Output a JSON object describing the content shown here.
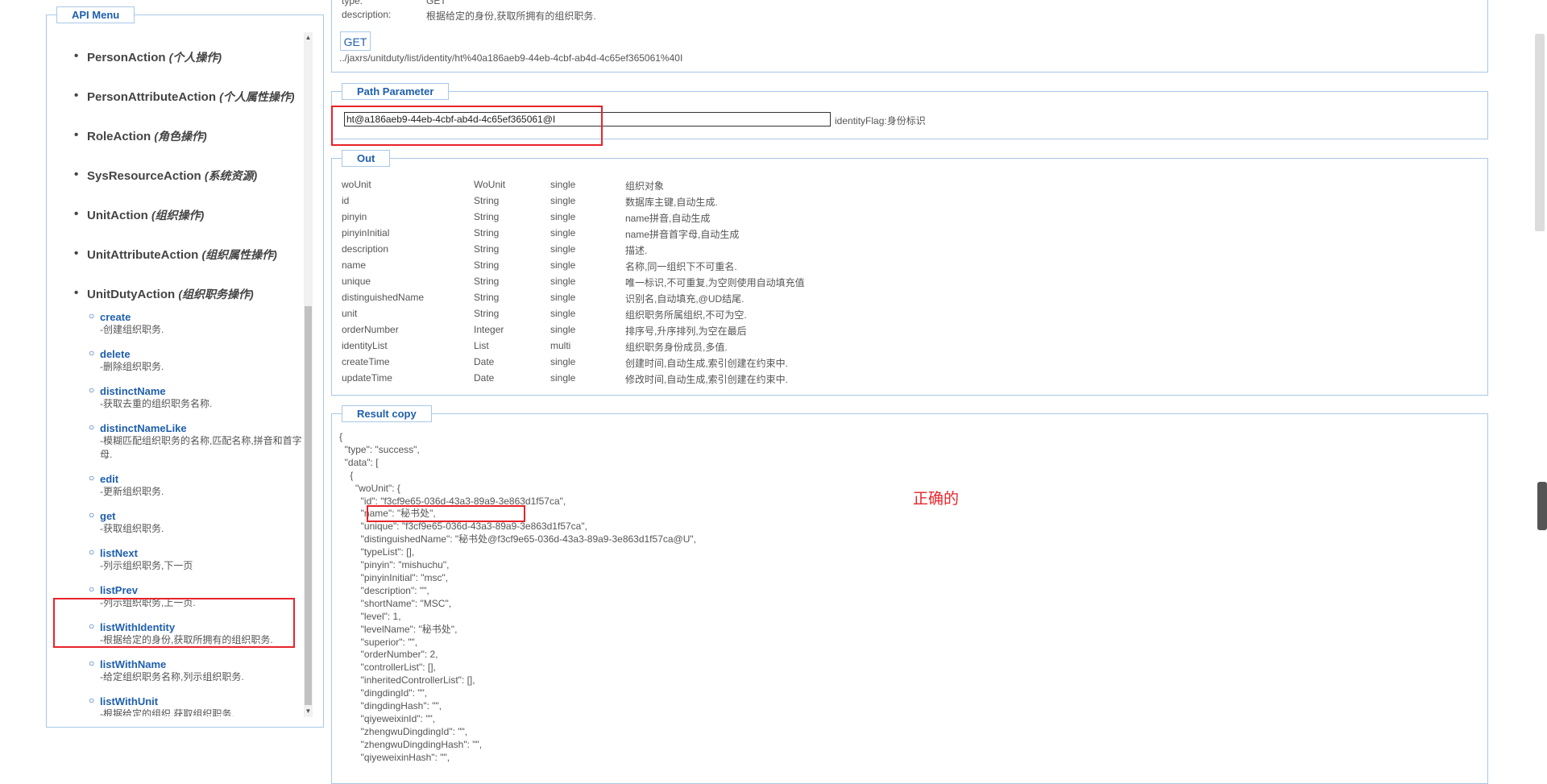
{
  "menu": {
    "title": "API Menu",
    "actions": [
      {
        "name": "PersonAction",
        "cn": "(个人操作)"
      },
      {
        "name": "PersonAttributeAction",
        "cn": "(个人属性操作)"
      },
      {
        "name": "RoleAction",
        "cn": "(角色操作)"
      },
      {
        "name": "SysResourceAction",
        "cn": "(系统资源)"
      },
      {
        "name": "UnitAction",
        "cn": "(组织操作)"
      },
      {
        "name": "UnitAttributeAction",
        "cn": "(组织属性操作)"
      },
      {
        "name": "UnitDutyAction",
        "cn": "(组织职务操作)"
      }
    ],
    "sub_items": [
      {
        "name": "create",
        "desc": "-创建组织职务."
      },
      {
        "name": "delete",
        "desc": "-删除组织职务."
      },
      {
        "name": "distinctName",
        "desc": "-获取去重的组织职务名称."
      },
      {
        "name": "distinctNameLike",
        "desc": "-模糊匹配组织职务的名称,匹配名称,拼音和首字母."
      },
      {
        "name": "edit",
        "desc": "-更新组织职务."
      },
      {
        "name": "get",
        "desc": "-获取组织职务."
      },
      {
        "name": "listNext",
        "desc": "-列示组织职务,下一页"
      },
      {
        "name": "listPrev",
        "desc": "-列示组织职务,上一页."
      },
      {
        "name": "listWithIdentity",
        "desc": "-根据给定的身份,获取所拥有的组织职务."
      },
      {
        "name": "listWithName",
        "desc": "-给定组织职务名称,列示组织职务."
      },
      {
        "name": "listWithUnit",
        "desc": "-根据给定的组织,获取组织职务."
      }
    ]
  },
  "top": {
    "type_label": "type:",
    "type_value": "GET",
    "desc_label": "description:",
    "desc_value": "根据给定的身份,获取所拥有的组织职务.",
    "get_button": "GET",
    "url": "../jaxrs/unitduty/list/identity/ht%40a186aeb9-44eb-4cbf-ab4d-4c65ef365061%40I"
  },
  "path_parameter": {
    "title": "Path Parameter",
    "input_value": "ht@a186aeb9-44eb-4cbf-ab4d-4c65ef365061@I",
    "hint": "identityFlag:身份标识"
  },
  "out": {
    "title": "Out",
    "rows": [
      [
        "woUnit",
        "WoUnit",
        "single",
        "组织对象"
      ],
      [
        "id",
        "String",
        "single",
        "数据库主键,自动生成."
      ],
      [
        "pinyin",
        "String",
        "single",
        "name拼音,自动生成"
      ],
      [
        "pinyinInitial",
        "String",
        "single",
        "name拼音首字母,自动生成"
      ],
      [
        "description",
        "String",
        "single",
        "描述."
      ],
      [
        "name",
        "String",
        "single",
        "名称,同一组织下不可重名."
      ],
      [
        "unique",
        "String",
        "single",
        "唯一标识,不可重复,为空则使用自动填充值"
      ],
      [
        "distinguishedName",
        "String",
        "single",
        "识别名,自动填充,@UD结尾."
      ],
      [
        "unit",
        "String",
        "single",
        "组织职务所属组织,不可为空."
      ],
      [
        "orderNumber",
        "Integer",
        "single",
        "排序号,升序排列,为空在最后"
      ],
      [
        "identityList",
        "List",
        "multi",
        "组织职务身份成员,多值."
      ],
      [
        "createTime",
        "Date",
        "single",
        "创建时间,自动生成,索引创建在约束中."
      ],
      [
        "updateTime",
        "Date",
        "single",
        "修改时间,自动生成,索引创建在约束中."
      ]
    ]
  },
  "result": {
    "title": "Result copy",
    "json_text": "{\n  \"type\": \"success\",\n  \"data\": [\n    {\n      \"woUnit\": {\n        \"id\": \"f3cf9e65-036d-43a3-89a9-3e863d1f57ca\",\n        \"name\": \"秘书处\",\n        \"unique\": \"f3cf9e65-036d-43a3-89a9-3e863d1f57ca\",\n        \"distinguishedName\": \"秘书处@f3cf9e65-036d-43a3-89a9-3e863d1f57ca@U\",\n        \"typeList\": [],\n        \"pinyin\": \"mishuchu\",\n        \"pinyinInitial\": \"msc\",\n        \"description\": \"\",\n        \"shortName\": \"MSC\",\n        \"level\": 1,\n        \"levelName\": \"秘书处\",\n        \"superior\": \"\",\n        \"orderNumber\": 2,\n        \"controllerList\": [],\n        \"inheritedControllerList\": [],\n        \"dingdingId\": \"\",\n        \"dingdingHash\": \"\",\n        \"qiyeweixinId\": \"\",\n        \"zhengwuDingdingId\": \"\",\n        \"zhengwuDingdingHash\": \"\",\n        \"qiyeweixinHash\": \"\","
  },
  "annotation": {
    "note": "正确的",
    "color": "#e8232a"
  },
  "colors": {
    "link": "#1f5fae",
    "border": "#a9c8e8"
  }
}
